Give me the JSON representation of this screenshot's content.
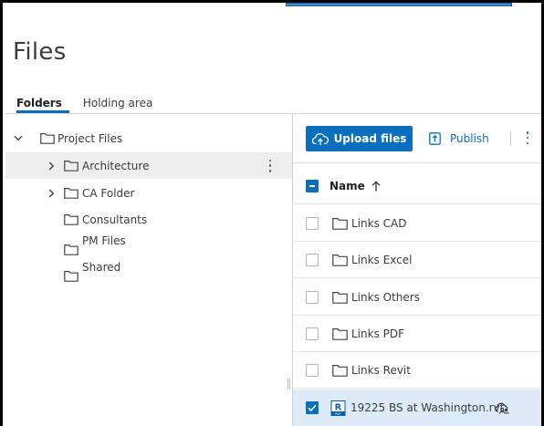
{
  "header": {
    "title": "Files"
  },
  "tabs": [
    {
      "label": "Folders",
      "active": true
    },
    {
      "label": "Holding area",
      "active": false
    }
  ],
  "tree": {
    "root": {
      "label": "Project Files",
      "expanded": true
    },
    "items": [
      {
        "label": "Architecture",
        "expandable": true,
        "hovered": true
      },
      {
        "label": "CA Folder",
        "expandable": true
      },
      {
        "label": "Consultants",
        "expandable": false
      },
      {
        "label": "PM Files",
        "expandable": false
      },
      {
        "label": "Shared",
        "expandable": false
      }
    ]
  },
  "toolbar": {
    "upload_label": "Upload files",
    "publish_label": "Publish"
  },
  "table": {
    "header_label": "Name",
    "sort": "ascending",
    "rows": [
      {
        "label": "Links CAD",
        "type": "folder",
        "checked": false
      },
      {
        "label": "Links Excel",
        "type": "folder",
        "checked": false
      },
      {
        "label": "Links Others",
        "type": "folder",
        "checked": false
      },
      {
        "label": "Links PDF",
        "type": "folder",
        "checked": false
      },
      {
        "label": "Links Revit",
        "type": "folder",
        "checked": false
      },
      {
        "label": "19225 BS at Washington.rvt",
        "type": "revit-file",
        "checked": true
      }
    ]
  },
  "colors": {
    "accent": "#0a6fbd",
    "selected_row": "#dcebf7",
    "hover_row": "#eeeeee"
  }
}
